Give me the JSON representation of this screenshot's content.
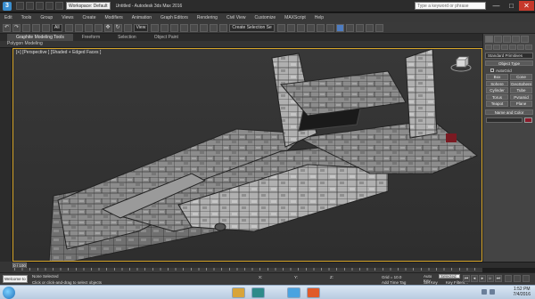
{
  "title_bar": {
    "workspace": "Workspace: Default",
    "title": "Untitled - Autodesk 3ds Max 2016",
    "search_placeholder": "Type a keyword or phrase",
    "minimize": "—",
    "maximize": "□",
    "close": "✕"
  },
  "menu": {
    "items": [
      "Edit",
      "Tools",
      "Group",
      "Views",
      "Create",
      "Modifiers",
      "Animation",
      "Graph Editors",
      "Rendering",
      "Civil View",
      "Customize",
      "MAXScript",
      "Help"
    ]
  },
  "toolbar": {
    "filter": "All",
    "coord_system": "View",
    "named_sel": "Create Selection Se"
  },
  "ribbon": {
    "tabs": [
      "Graphite Modeling Tools",
      "Freeform",
      "Selection",
      "Object Paint"
    ],
    "sub_label": "Polygon Modeling"
  },
  "viewport": {
    "label": "[+] [Perspective ] [Shaded + Edged Faces ]"
  },
  "command_panel": {
    "category": "Standard Primitives",
    "object_type": "Object Type",
    "autogrid": "AutoGrid",
    "primitives": [
      "Box",
      "Cone",
      "Sphere",
      "GeoSphere",
      "Cylinder",
      "Tube",
      "Torus",
      "Pyramid",
      "Teapot",
      "Plane"
    ],
    "name_and_color": "Name and Color",
    "color": "#8a1a2a"
  },
  "timeline": {
    "position": "0 / 100"
  },
  "status": {
    "maxscript": "Welcome to M",
    "selection": "None Selected",
    "prompt": "Click or click-and-drag to select objects",
    "x_label": "X:",
    "y_label": "Y:",
    "z_label": "Z:",
    "grid": "Grid = 10.0",
    "add_time_tag": "Add Time Tag",
    "auto_key": "Auto Key",
    "selected": "Selected",
    "set_key": "Set Key",
    "key_filters": "Key Filters..."
  },
  "taskbar": {
    "time": "1:52 PM",
    "date": "7/4/2016"
  }
}
